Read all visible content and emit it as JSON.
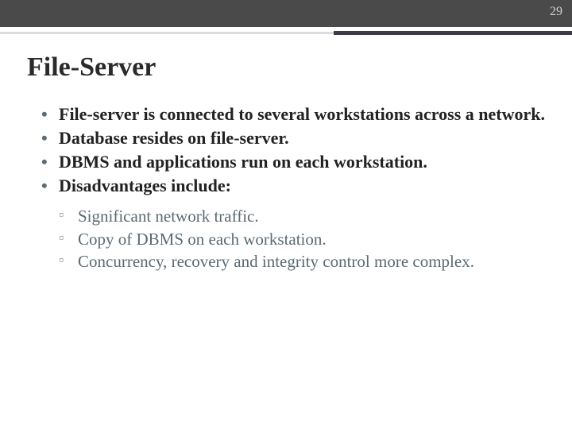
{
  "page_number": "29",
  "title": "File-Server",
  "bullets": [
    "File-server is connected to several workstations across a network.",
    "Database resides on file-server.",
    "DBMS and applications run on each workstation.",
    "Disadvantages include:"
  ],
  "sub_bullets": [
    "Significant network traffic.",
    "Copy of DBMS on each workstation.",
    "Concurrency, recovery and integrity control more complex."
  ]
}
